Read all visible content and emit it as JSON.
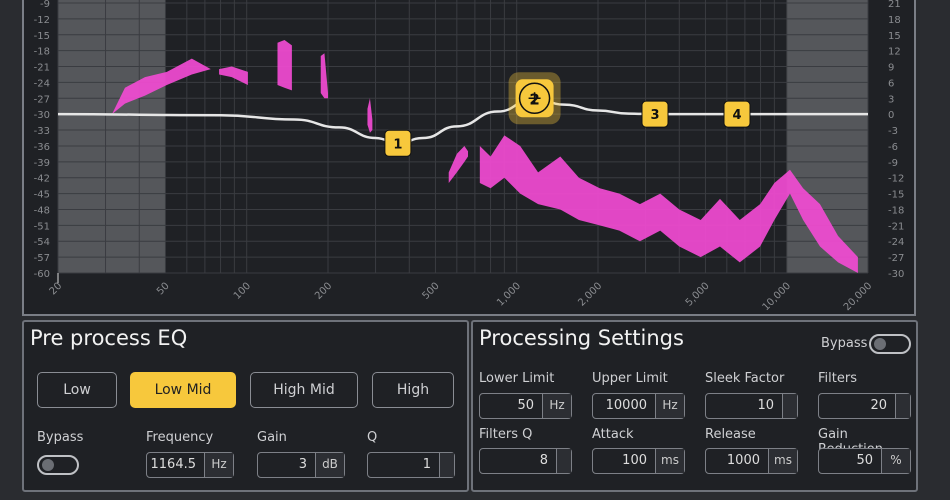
{
  "chart_data": {
    "type": "area",
    "x_scale": "log",
    "xlim": [
      20,
      20000
    ],
    "ylim_left": [
      -60,
      -9
    ],
    "ylim_right": [
      -30,
      21
    ],
    "grid": true,
    "x_tick_labels": [
      "20",
      "50",
      "100",
      "200",
      "500",
      "1,000",
      "2,000",
      "5,000",
      "10,000",
      "20,000"
    ],
    "x_tick_values": [
      20,
      50,
      100,
      200,
      500,
      1000,
      2000,
      5000,
      10000,
      20000
    ],
    "y_left_ticks": [
      -9,
      -12,
      -15,
      -18,
      -21,
      -24,
      -27,
      -30,
      -33,
      -36,
      -39,
      -42,
      -45,
      -48,
      -51,
      -54,
      -57,
      -60
    ],
    "y_right_ticks": [
      21,
      18,
      15,
      12,
      9,
      6,
      3,
      0,
      -3,
      -6,
      -9,
      -12,
      -15,
      -18,
      -21,
      -24,
      -27,
      -30
    ],
    "inactive_ranges_hz": [
      [
        20,
        50
      ],
      [
        10000,
        20000
      ]
    ],
    "eq_curve_db_right": [
      [
        20,
        0
      ],
      [
        80,
        -0.2
      ],
      [
        150,
        -1
      ],
      [
        220,
        -2.5
      ],
      [
        300,
        -4.5
      ],
      [
        363,
        -5.5
      ],
      [
        450,
        -4.5
      ],
      [
        600,
        -2.3
      ],
      [
        850,
        0.5
      ],
      [
        1164,
        3
      ],
      [
        1500,
        1.8
      ],
      [
        2000,
        0.7
      ],
      [
        2600,
        0.1
      ],
      [
        3252,
        0
      ],
      [
        6544,
        0
      ],
      [
        20000,
        0
      ]
    ],
    "eq_nodes": [
      {
        "label": "1",
        "freq": 363,
        "gain": -5.5,
        "selected": false
      },
      {
        "label": "2",
        "freq": 1164.5,
        "gain": 3,
        "selected": true
      },
      {
        "label": "3",
        "freq": 3252,
        "gain": 0,
        "selected": false
      },
      {
        "label": "4",
        "freq": 6544,
        "gain": 0,
        "selected": false
      }
    ],
    "spectrum_segments_db_left": [
      [
        [
          31.7,
          -30,
          -30
        ],
        [
          35.4,
          -25,
          -28
        ],
        [
          42,
          -23,
          -26.5
        ],
        [
          50.6,
          -22,
          -24.5
        ],
        [
          62.6,
          -19.5,
          -22.5
        ],
        [
          73.6,
          -21.5,
          -21.5
        ]
      ],
      [
        [
          79,
          -21.5,
          -22.5
        ],
        [
          88,
          -21,
          -23
        ],
        [
          101,
          -22,
          -24.5
        ]
      ],
      [
        [
          130,
          -16.5,
          -24.5
        ],
        [
          138,
          -16,
          -25
        ],
        [
          147,
          -17,
          -25.5
        ]
      ],
      [
        [
          188,
          -19,
          -26
        ],
        [
          194,
          -18.5,
          -27
        ],
        [
          200,
          -26,
          -27
        ]
      ],
      [
        [
          280,
          -29,
          -32
        ],
        [
          286,
          -27,
          -33.5
        ],
        [
          292,
          -31,
          -33
        ]
      ],
      [
        [
          560,
          -41,
          -43
        ],
        [
          600,
          -37.5,
          -41
        ],
        [
          640,
          -36,
          -39
        ],
        [
          660,
          -37,
          -38
        ]
      ],
      [
        [
          730,
          -36,
          -43
        ],
        [
          800,
          -38,
          -44
        ],
        [
          900,
          -34,
          -42
        ],
        [
          1030,
          -36,
          -45
        ],
        [
          1200,
          -41,
          -47
        ],
        [
          1450,
          -38,
          -48
        ],
        [
          1700,
          -42,
          -50
        ],
        [
          2030,
          -44,
          -51
        ],
        [
          2400,
          -45,
          -52
        ],
        [
          2860,
          -47,
          -54
        ],
        [
          3400,
          -45,
          -52
        ],
        [
          4000,
          -48,
          -55
        ],
        [
          4800,
          -50,
          -57
        ],
        [
          5660,
          -46,
          -55
        ],
        [
          6700,
          -50,
          -58
        ],
        [
          7970,
          -47,
          -55
        ],
        [
          9000,
          -43,
          -50
        ],
        [
          10280,
          -40.5,
          -45
        ],
        [
          11500,
          -44,
          -50
        ],
        [
          13280,
          -47,
          -55
        ],
        [
          15500,
          -53,
          -58
        ],
        [
          18350,
          -57,
          -60
        ]
      ]
    ]
  },
  "colors": {
    "accent": "#f7c83c",
    "spectrum": "#f24bd2",
    "curve": "#e6e6e6"
  },
  "pre_eq": {
    "title": "Pre process EQ",
    "bands": [
      {
        "label": "Low",
        "active": false
      },
      {
        "label": "Low Mid",
        "active": true
      },
      {
        "label": "High Mid",
        "active": false
      },
      {
        "label": "High",
        "active": false
      }
    ],
    "bypass_label": "Bypass",
    "bypass_on": false,
    "frequency": {
      "label": "Frequency",
      "value": "1164.5",
      "unit": "Hz"
    },
    "gain": {
      "label": "Gain",
      "value": "3",
      "unit": "dB"
    },
    "q": {
      "label": "Q",
      "value": "1",
      "unit": ""
    }
  },
  "processing": {
    "title": "Processing Settings",
    "bypass_label": "Bypass",
    "bypass_on": false,
    "fields": [
      {
        "label": "Lower Limit",
        "value": "50",
        "unit": "Hz"
      },
      {
        "label": "Upper Limit",
        "value": "10000",
        "unit": "Hz"
      },
      {
        "label": "Sleek Factor",
        "value": "10",
        "unit": ""
      },
      {
        "label": "Filters",
        "value": "20",
        "unit": ""
      },
      {
        "label": "Filters Q",
        "value": "8",
        "unit": ""
      },
      {
        "label": "Attack",
        "value": "100",
        "unit": "ms"
      },
      {
        "label": "Release",
        "value": "1000",
        "unit": "ms"
      },
      {
        "label": "Gain Reduction",
        "value": "50",
        "unit": "%"
      }
    ]
  }
}
